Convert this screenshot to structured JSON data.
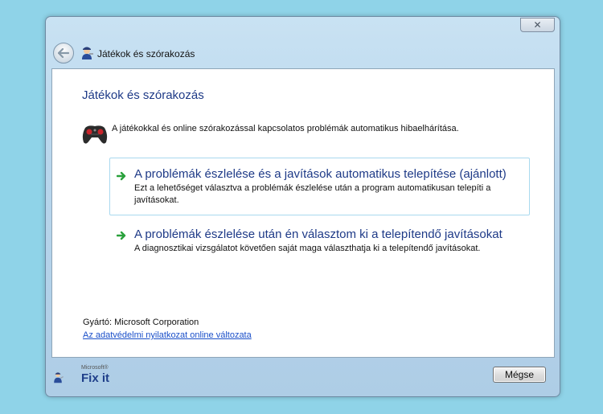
{
  "window": {
    "title": "Játékok és szórakozás",
    "close_glyph": "✕"
  },
  "main": {
    "heading": "Játékok és szórakozás",
    "description": "A játékokkal és online szórakozással kapcsolatos problémák automatikus hibaelhárítása.",
    "options": [
      {
        "title": "A problémák észlelése és a javítások automatikus telepítése (ajánlott)",
        "subtitle": "Ezt a lehetőséget választva a problémák észlelése után a program automatikusan telepíti a javításokat."
      },
      {
        "title": "A problémák észlelése után én választom ki a telepítendő javításokat",
        "subtitle": "A diagnosztikai vizsgálatot követően saját maga választhatja ki a telepítendő javításokat."
      }
    ],
    "manufacturer": "Gyártó: Microsoft Corporation",
    "privacy_link": "Az adatvédelmi nyilatkozat online változata"
  },
  "footer": {
    "brand_small": "Microsoft®",
    "brand": "Fix it",
    "cancel_label": "Mégse"
  },
  "colors": {
    "background": "#8fd3e8",
    "heading": "#1e3a87",
    "link": "#1a4fc9",
    "arrow": "#2aa13c",
    "highlight_border": "#a9d9ef"
  },
  "icons": {
    "back": "back-arrow-icon",
    "title": "fixit-mechanic-icon",
    "category": "gamepad-icon",
    "option": "green-arrow-icon",
    "footer": "fixit-logo"
  }
}
